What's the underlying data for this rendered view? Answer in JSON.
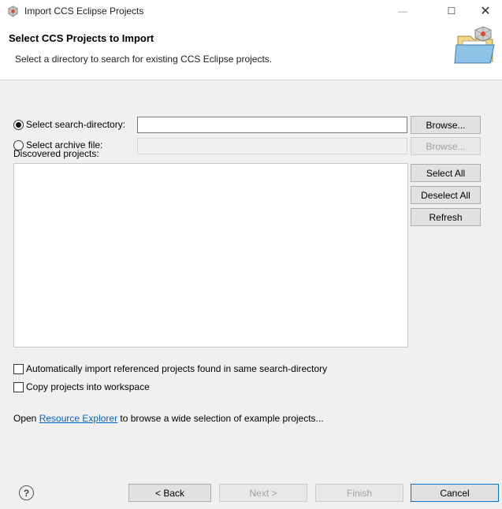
{
  "window": {
    "title": "Import CCS Eclipse Projects",
    "minimize_glyph": "—",
    "maximize_glyph": "☐",
    "close_glyph": "✕"
  },
  "banner": {
    "title": "Select CCS Projects to Import",
    "description": "Select a directory to search for existing CCS Eclipse projects."
  },
  "source": {
    "search_directory_label": "Select search-directory:",
    "search_directory_value": "",
    "search_directory_selected": true,
    "archive_file_label": "Select archive file:",
    "archive_file_value": "",
    "browse_label": "Browse...",
    "browse_archive_label": "Browse..."
  },
  "projects": {
    "label": "Discovered projects:",
    "items": [],
    "select_all_label": "Select All",
    "deselect_all_label": "Deselect All",
    "refresh_label": "Refresh"
  },
  "options": {
    "auto_import_label": "Automatically import referenced projects found in same search-directory",
    "copy_label": "Copy projects into workspace"
  },
  "explorer_hint": {
    "prefix": "Open ",
    "link": "Resource Explorer",
    "suffix": " to browse a wide selection of example projects..."
  },
  "footer": {
    "help_glyph": "?",
    "back_label": "< Back",
    "next_label": "Next >",
    "finish_label": "Finish",
    "cancel_label": "Cancel"
  },
  "colors": {
    "link": "#0066cc",
    "background": "#f0f0f0",
    "banner": "#ffffff"
  }
}
